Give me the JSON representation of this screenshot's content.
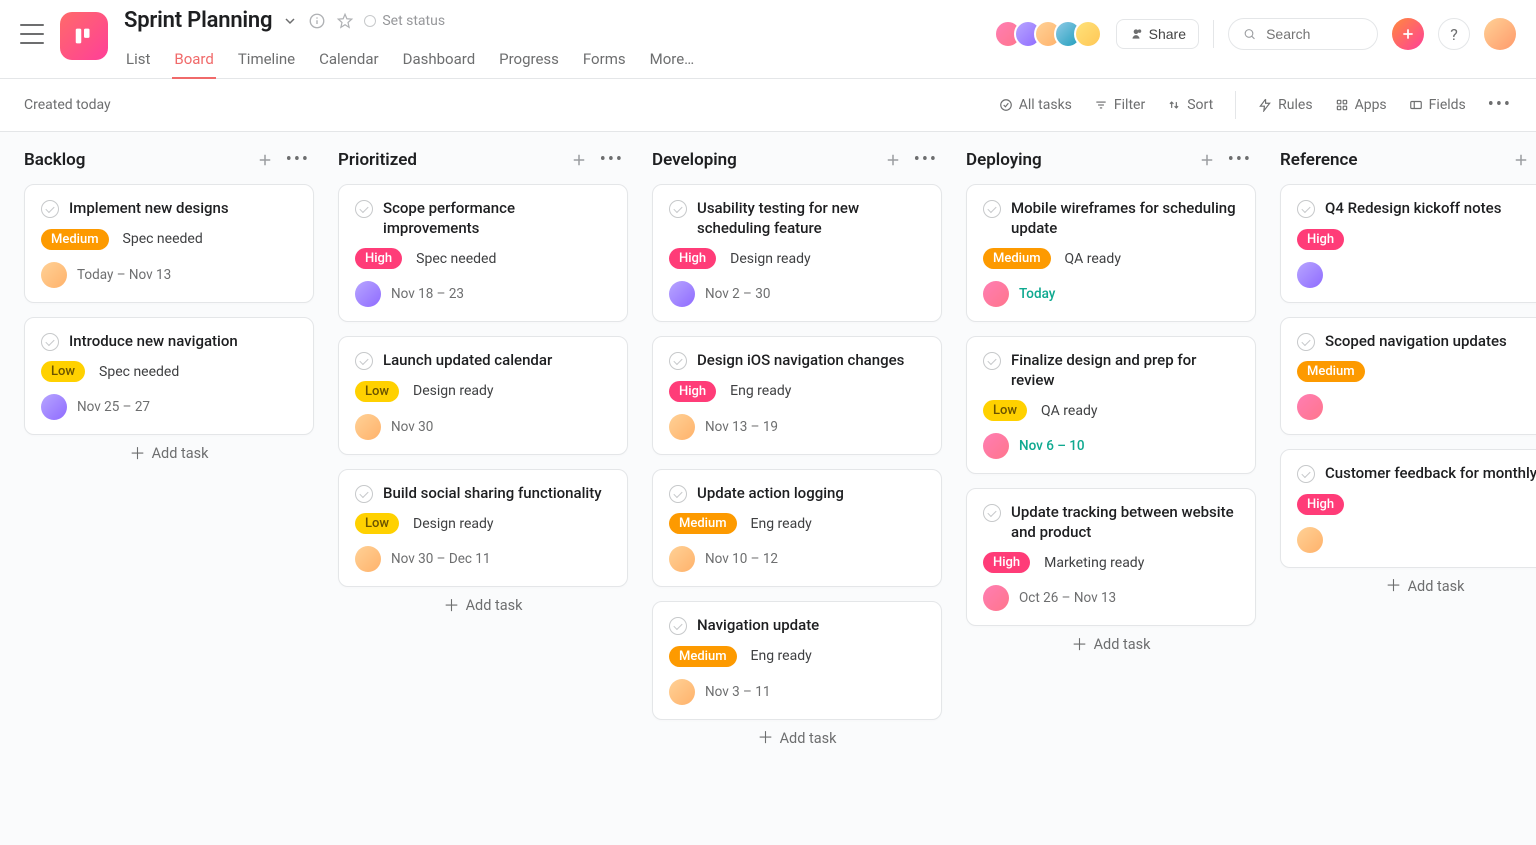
{
  "header": {
    "title": "Sprint Planning",
    "set_status": "Set status",
    "tabs": [
      "List",
      "Board",
      "Timeline",
      "Calendar",
      "Dashboard",
      "Progress",
      "Forms",
      "More…"
    ],
    "active_tab": 1,
    "share": "Share",
    "search_placeholder": "Search"
  },
  "toolbar": {
    "created": "Created today",
    "all_tasks": "All tasks",
    "filter": "Filter",
    "sort": "Sort",
    "rules": "Rules",
    "apps": "Apps",
    "fields": "Fields"
  },
  "add_task_label": "Add task",
  "columns": [
    {
      "title": "Backlog",
      "cards": [
        {
          "title": "Implement new designs",
          "priority": "Medium",
          "status": "Spec needed",
          "assignee": "a3",
          "due": "Today – Nov 13",
          "teal": false
        },
        {
          "title": "Introduce new navigation",
          "priority": "Low",
          "status": "Spec needed",
          "assignee": "a2",
          "due": "Nov 25 – 27",
          "teal": false
        }
      ]
    },
    {
      "title": "Prioritized",
      "cards": [
        {
          "title": "Scope performance improvements",
          "priority": "High",
          "status": "Spec needed",
          "assignee": "a2",
          "due": "Nov 18 – 23",
          "teal": false
        },
        {
          "title": "Launch updated calendar",
          "priority": "Low",
          "status": "Design ready",
          "assignee": "a3",
          "due": "Nov 30",
          "teal": false
        },
        {
          "title": "Build social sharing functionality",
          "priority": "Low",
          "status": "Design ready",
          "assignee": "a3",
          "due": "Nov 30 – Dec 11",
          "teal": false
        }
      ]
    },
    {
      "title": "Developing",
      "cards": [
        {
          "title": "Usability testing for new scheduling feature",
          "priority": "High",
          "status": "Design ready",
          "assignee": "a2",
          "due": "Nov 2 – 30",
          "teal": false
        },
        {
          "title": "Design iOS navigation changes",
          "priority": "High",
          "status": "Eng ready",
          "assignee": "a3",
          "due": "Nov 13 – 19",
          "teal": false
        },
        {
          "title": "Update action logging",
          "priority": "Medium",
          "status": "Eng ready",
          "assignee": "a3",
          "due": "Nov 10 – 12",
          "teal": false
        },
        {
          "title": "Navigation update",
          "priority": "Medium",
          "status": "Eng ready",
          "assignee": "a3",
          "due": "Nov 3 – 11",
          "teal": false
        }
      ]
    },
    {
      "title": "Deploying",
      "cards": [
        {
          "title": "Mobile wireframes for scheduling update",
          "priority": "Medium",
          "status": "QA ready",
          "assignee": "a1",
          "due": "Today",
          "teal": true
        },
        {
          "title": "Finalize design and prep for review",
          "priority": "Low",
          "status": "QA ready",
          "assignee": "a1",
          "due": "Nov 6 – 10",
          "teal": true
        },
        {
          "title": "Update tracking between website and product",
          "priority": "High",
          "status": "Marketing ready",
          "assignee": "a1",
          "due": "Oct 26 – Nov 13",
          "teal": false
        }
      ]
    },
    {
      "title": "Reference",
      "cards": [
        {
          "title": "Q4 Redesign kickoff notes",
          "priority": "High",
          "status": "",
          "assignee": "a2",
          "due": "",
          "teal": false
        },
        {
          "title": "Scoped navigation updates",
          "priority": "Medium",
          "status": "",
          "assignee": "a1",
          "due": "",
          "teal": false
        },
        {
          "title": "Customer feedback for monthly",
          "priority": "High",
          "status": "",
          "assignee": "a3",
          "due": "",
          "teal": false
        }
      ]
    }
  ]
}
